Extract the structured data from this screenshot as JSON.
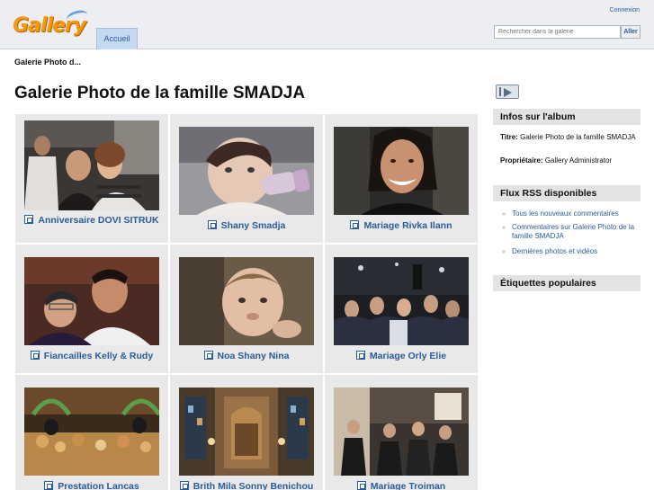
{
  "header": {
    "logo_text": "Gallery",
    "nav_tab": "Accueil",
    "login_link": "Connexion",
    "search_placeholder": "Rechercher dans la galerie",
    "search_button": "Aller"
  },
  "breadcrumb": "Galerie Photo d...",
  "page_title": "Galerie Photo de la famille SMADJA",
  "albums": [
    {
      "label": "Anniversaire DOVI SITRUK",
      "icon": "album-icon"
    },
    {
      "label": "Shany Smadja",
      "icon": "album-icon"
    },
    {
      "label": "Mariage Rivka Ilann",
      "icon": "album-icon"
    },
    {
      "label": "Fiancailles Kelly & Rudy",
      "icon": "album-icon"
    },
    {
      "label": "Noa Shany Nina",
      "icon": "album-icon"
    },
    {
      "label": "Mariage Orly Elie",
      "icon": "album-icon"
    },
    {
      "label": "Prestation Lancas",
      "icon": "album-icon"
    },
    {
      "label": "Brith Mila Sonny Benichou",
      "icon": "album-icon"
    },
    {
      "label": "Mariage Troiman",
      "icon": "album-icon"
    }
  ],
  "sidebar": {
    "slideshow_icon": "slideshow-icon",
    "album_info": {
      "heading": "Infos sur l'album",
      "title_label": "Titre:",
      "title_value": "Galerie Photo de la famille SMADJA",
      "owner_label": "Propriétaire:",
      "owner_value": "Gallery Administrator"
    },
    "rss": {
      "heading": "Flux RSS disponibles",
      "items": [
        "Tous les nouveaux commentaires",
        "Commentaires sur Galerie Photo de la famille SMADJA",
        "Dernières photos et vidéos"
      ]
    },
    "tags": {
      "heading": "Étiquettes populaires"
    }
  }
}
